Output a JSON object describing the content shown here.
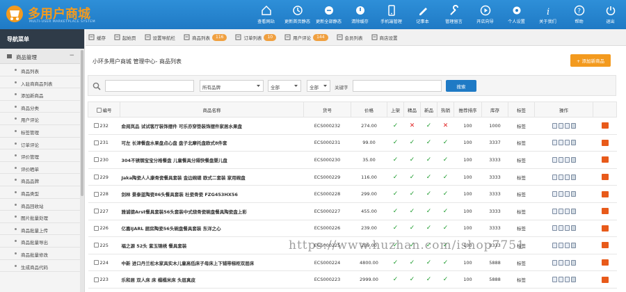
{
  "brand": {
    "name": "多用户商城",
    "subtitle": "MULTI-USER MARKETPLACE SYSTEM"
  },
  "topnav": [
    {
      "label": "查看网站",
      "icon": "home-icon"
    },
    {
      "label": "更新首页静态",
      "icon": "refresh-home-icon"
    },
    {
      "label": "更新全部静态",
      "icon": "refresh-all-icon"
    },
    {
      "label": "清除缓存",
      "icon": "clear-cache-icon"
    },
    {
      "label": "手机端管理",
      "icon": "mobile-icon"
    },
    {
      "label": "记事本",
      "icon": "notepad-icon"
    },
    {
      "label": "管理留言",
      "icon": "wrench-icon"
    },
    {
      "label": "开店向导",
      "icon": "play-icon"
    },
    {
      "label": "个人设置",
      "icon": "gear-icon"
    },
    {
      "label": "关于我们",
      "icon": "info-icon"
    },
    {
      "label": "帮助",
      "icon": "help-icon"
    },
    {
      "label": "退出",
      "icon": "power-icon"
    }
  ],
  "sidebar": {
    "title": "导航菜单",
    "group": "商品管理",
    "items": [
      "商品列表",
      "入驻商商品列表",
      "添加新商品",
      "商品分类",
      "用户评论",
      "标签管理",
      "订单评论",
      "评价管理",
      "评价晒单",
      "商品品牌",
      "商品类型",
      "商品回收站",
      "图片批量处理",
      "商品批量上传",
      "商品批量导出",
      "商品批量修改",
      "生成商品代码"
    ]
  },
  "tabs": [
    {
      "label": "缓存",
      "badge": ""
    },
    {
      "label": "起始页",
      "badge": ""
    },
    {
      "label": "设置导航栏",
      "badge": ""
    },
    {
      "label": "商品列表",
      "badge": "116"
    },
    {
      "label": "订单列表",
      "badge": "10"
    },
    {
      "label": "用户评论",
      "badge": "144"
    },
    {
      "label": "会员列表",
      "badge": ""
    },
    {
      "label": "商店设置",
      "badge": ""
    }
  ],
  "breadcrumb": "小环多用户商城 管理中心- 商品列表",
  "add_button": "+ 添加新商品",
  "search": {
    "category_value": "",
    "brand_value": "所有品牌",
    "select1_value": "全部",
    "select2_value": "全部",
    "keyword_label": "关键字",
    "keyword_value": "",
    "button": "搜索"
  },
  "table": {
    "headers": [
      "编号",
      "商品名称",
      "货号",
      "价格",
      "上架",
      "精品",
      "新品",
      "热销",
      "推荐排序",
      "库存",
      "标签",
      "操作"
    ],
    "rows": [
      {
        "id": "232",
        "name": "俞阅岚品 试试客厅装饰摆件 可乐亦穿垫装饰摆件家居水果盘",
        "sn": "ECS000232",
        "price": "274.00",
        "onsale": true,
        "best": false,
        "new": true,
        "hot": false,
        "sort": "100",
        "stock": "1000",
        "tag": "标签"
      },
      {
        "id": "231",
        "name": "可左 长津餐盘水果盘点心盘 盘子北摩托盘欧式8件套",
        "sn": "ECS000231",
        "price": "99.00",
        "onsale": true,
        "best": true,
        "new": true,
        "hot": true,
        "sort": "100",
        "stock": "3337",
        "tag": "标签"
      },
      {
        "id": "230",
        "name": "304不锈钢宝宝分格餐盘 儿童餐具分隔快餐盘婴儿盘",
        "sn": "ECS000230",
        "price": "35.00",
        "onsale": true,
        "best": true,
        "new": true,
        "hot": true,
        "sort": "100",
        "stock": "3333",
        "tag": "标签"
      },
      {
        "id": "229",
        "name": "Jaka陶瓷人人康骨瓷餐具套装 金边碗碟 欧式二套装 家用碗盘",
        "sn": "ECS000229",
        "price": "116.00",
        "onsale": true,
        "best": true,
        "new": true,
        "hot": true,
        "sort": "100",
        "stock": "3333",
        "tag": "标签"
      },
      {
        "id": "228",
        "name": "剑林 景泰蓝陶瓷86头餐具套装 杜瓷骨瓷 FZG453HX56",
        "sn": "ECS000228",
        "price": "299.00",
        "onsale": true,
        "best": true,
        "new": true,
        "hot": true,
        "sort": "100",
        "stock": "3333",
        "tag": "标签"
      },
      {
        "id": "227",
        "name": "雅诚德Arst餐具套装56头套装中式烧骨瓷碗盘餐具陶瓷盘上彩",
        "sn": "ECS000227",
        "price": "455.00",
        "onsale": true,
        "best": true,
        "new": true,
        "hot": true,
        "sort": "100",
        "stock": "3333",
        "tag": "标签"
      },
      {
        "id": "226",
        "name": "亿嘉IJARL 厨房陶瓷56头碗盘餐具套装 东洋之心",
        "sn": "ECS000226",
        "price": "239.00",
        "onsale": true,
        "best": true,
        "new": true,
        "hot": true,
        "sort": "100",
        "stock": "3333",
        "tag": "标签"
      },
      {
        "id": "225",
        "name": "福之源 52头 紫玉锦绣 餐具套装",
        "sn": "ECS000225",
        "price": "239.00",
        "onsale": true,
        "best": true,
        "new": true,
        "hot": true,
        "sort": "100",
        "stock": "3333",
        "tag": "标签"
      },
      {
        "id": "224",
        "name": "中新 进口丹兰松木家具实木儿童高低床子母床上下铺带梯柜双层床",
        "sn": "ECS000224",
        "price": "4800.00",
        "onsale": true,
        "best": true,
        "new": true,
        "hot": true,
        "sort": "100",
        "stock": "5888",
        "tag": "标签"
      },
      {
        "id": "223",
        "name": "乐和居 双人床 床 榻榻米床 头层真皮",
        "sn": "ECS000223",
        "price": "2999.00",
        "onsale": true,
        "best": true,
        "new": true,
        "hot": true,
        "sort": "100",
        "stock": "5888",
        "tag": "标签"
      }
    ]
  },
  "watermark": "https://www.huzhan.com/ishop7751",
  "colors": {
    "topbar": "#2e8fd8",
    "accent": "#f39a1e",
    "check": "#1a9a2a",
    "cross": "#e02020"
  }
}
